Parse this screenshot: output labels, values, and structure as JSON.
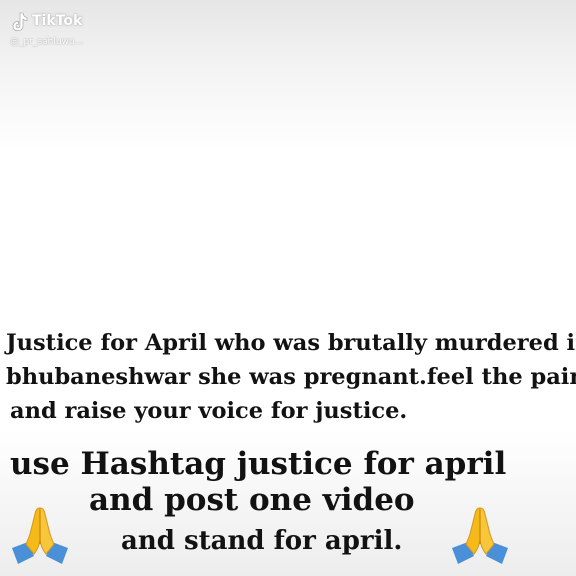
{
  "watermark": {
    "brand": "TikTok",
    "username": "@_pr_sahluwu...",
    "logo_icon": "tiktok-note-icon",
    "text_color": "#ffffff"
  },
  "caption": {
    "lines": [
      "Justice for April who was brutally murdered in",
      "bhubaneshwar she was pregnant.feel the pain",
      "and raise your voice for justice."
    ]
  },
  "call_to_action": {
    "lines": [
      "use Hashtag justice for april",
      "and post one video",
      "and stand for april."
    ]
  },
  "emoji": {
    "left": "folded-hands-icon",
    "right": "folded-hands-icon",
    "skin_color": "#f5b91a",
    "sleeve_color": "#4a90d9"
  },
  "colors": {
    "text": "#121212",
    "background": "#ffffff"
  }
}
